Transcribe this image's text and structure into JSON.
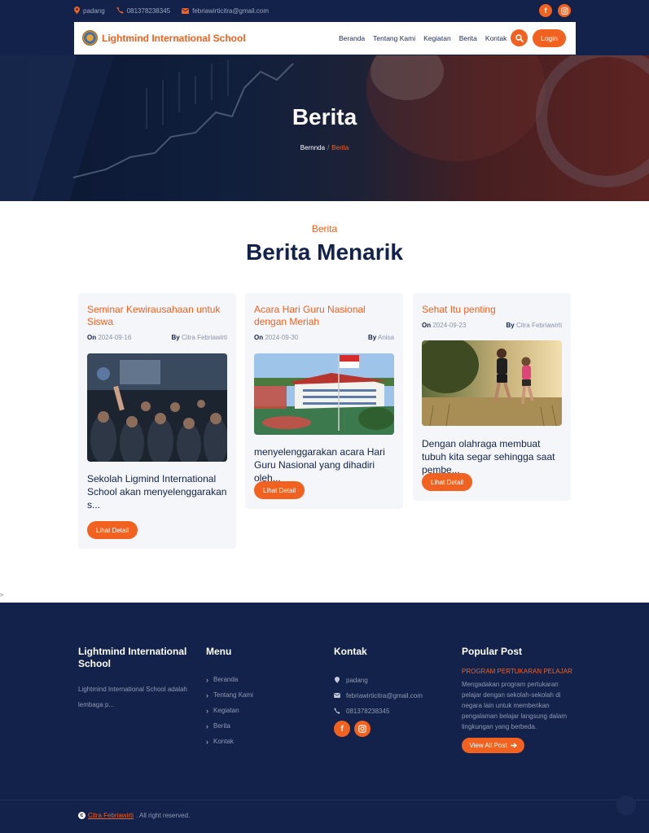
{
  "topbar": {
    "location": "padang",
    "phone": "081378238345",
    "email": "febriawirticitra@gmail.com",
    "social": [
      "facebook-icon",
      "instagram-icon"
    ]
  },
  "navbar": {
    "brand": "Lightmind International School",
    "menu": [
      "Beranda",
      "Tentang Kami",
      "Kegiatan",
      "Berita",
      "Kontak"
    ],
    "login_label": "Login"
  },
  "hero": {
    "title": "Berita",
    "breadcrumb_home": "Bernnda",
    "breadcrumb_sep": "/",
    "breadcrumb_current": "Berita"
  },
  "section": {
    "subtitle": "Berita",
    "title": "Berita Menarik"
  },
  "cards": [
    {
      "title": "Seminar Kewirausahaan untuk Siswa",
      "on_label": "On",
      "date": "2024-09-16",
      "by_label": "By",
      "author": "Citra Febriawirti",
      "excerpt": "Sekolah Ligmind International School akan menyelenggarakan s...",
      "button": "Lihat Detail",
      "image": "seminar-audience-photo"
    },
    {
      "title": "Acara Hari Guru Nasional dengan Meriah",
      "on_label": "On",
      "date": "2024-09-30",
      "by_label": "By",
      "author": "Anisa",
      "excerpt": "menyelenggarakan acara Hari Guru Nasional yang dihadiri oleh...",
      "button": "Lihat Detail",
      "image": "school-building-photo"
    },
    {
      "title": "Sehat Itu penting",
      "on_label": "On",
      "date": "2024-09-23",
      "by_label": "By",
      "author": "Citra Febriawirti",
      "excerpt": "Dengan olahraga membuat tubuh kita segar sehingga saat pembe...",
      "button": "Lihat Detail",
      "image": "runners-photo"
    }
  ],
  "stray_mark": ">",
  "footer": {
    "about_title": "Lightmind International School",
    "about_text": "Lightmind International School adalah lembaga p...",
    "menu_title": "Menu",
    "menu": [
      "Beranda",
      "Tentang Kami",
      "Kegiatan",
      "Berita",
      "Kontak"
    ],
    "contact_title": "Kontak",
    "contact_location": "padang",
    "contact_email": "febriawirticitra@gmail.com",
    "contact_phone": "081378238345",
    "popular_title": "Popular Post",
    "popular_post_title": "PROGRAM PERTUKARAN PELAJAR",
    "popular_post_text": "Mengadakan program pertukaran pelajar dengan sekolah-sekolah di negara lain untuk memberikan pengalaman belajar langsung dalam lingkungan yang berbeda.",
    "view_all": "View All Post",
    "copyright_name": "Citra Febriawirti",
    "copyright_rest": ". All right reserved."
  },
  "colors": {
    "accent": "#f1611f",
    "navy": "#13224b",
    "card_bg": "#f4f6f9"
  }
}
